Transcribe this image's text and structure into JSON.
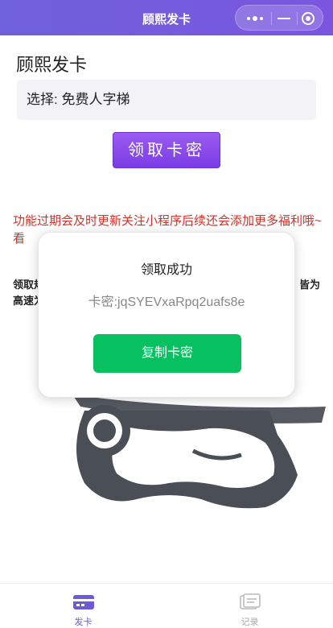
{
  "app": {
    "title": "顾熙发卡",
    "accent": "#7264dc"
  },
  "capsule": {
    "more_icon": "more-dots-icon",
    "minimize_icon": "minimize-icon",
    "close_icon": "target-close-icon"
  },
  "main": {
    "shop_title": "顾熙发卡",
    "select_text": "选择: 免费人字梯",
    "get_button": "领取卡密",
    "notice": "功能过期会及时更新关注小程序后续还会添加更多福利哦~看",
    "rules_line1_left": "领取规",
    "rules_line1_right": "皆为",
    "rules_line2": "高速为"
  },
  "modal": {
    "title": "领取成功",
    "code": "卡密:jqSYEVxaRpq2uafs8e",
    "copy_button": "复制卡密"
  },
  "tabbar": {
    "items": [
      {
        "label": "发卡",
        "icon": "card-icon",
        "active": true
      },
      {
        "label": "记录",
        "icon": "records-icon",
        "active": false
      }
    ]
  }
}
